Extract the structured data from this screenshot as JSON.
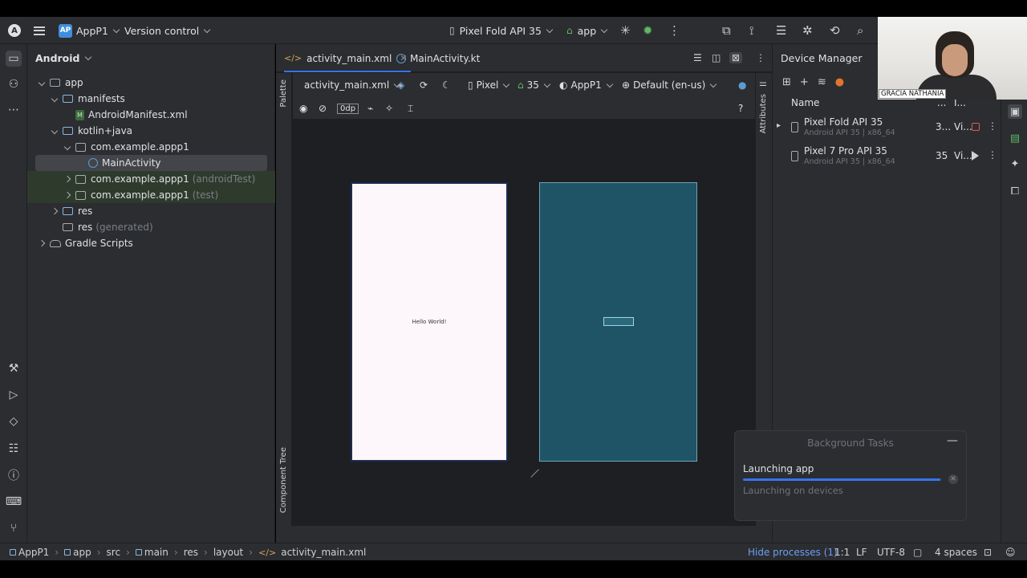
{
  "titlebar": {
    "project_badge": "AP",
    "project_name": "AppP1",
    "version_control": "Version control",
    "device": "Pixel Fold API 35",
    "run_config": "app"
  },
  "project_panel": {
    "view_mode": "Android",
    "tree": [
      {
        "label": "app",
        "suffix": ""
      },
      {
        "label": "manifests",
        "suffix": ""
      },
      {
        "label": "AndroidManifest.xml",
        "suffix": ""
      },
      {
        "label": "kotlin+java",
        "suffix": ""
      },
      {
        "label": "com.example.appp1",
        "suffix": ""
      },
      {
        "label": "MainActivity",
        "suffix": ""
      },
      {
        "label": "com.example.appp1",
        "suffix": "(androidTest)"
      },
      {
        "label": "com.example.appp1",
        "suffix": "(test)"
      },
      {
        "label": "res",
        "suffix": ""
      },
      {
        "label": "res",
        "suffix": "(generated)"
      },
      {
        "label": "Gradle Scripts",
        "suffix": ""
      }
    ]
  },
  "editor": {
    "tabs": [
      {
        "label": "activity_main.xml"
      },
      {
        "label": "MainActivity.kt"
      }
    ],
    "palette_label": "Palette",
    "component_tree_label": "Component Tree",
    "attributes_label": "Attributes",
    "toolbar": {
      "file": "activity_main.xml",
      "device": "Pixel",
      "api": "35",
      "theme": "AppP1",
      "locale": "Default (en-us)",
      "margin": "0dp",
      "help": "?"
    },
    "preview_text": "Hello World!"
  },
  "device_manager": {
    "title": "Device Manager",
    "column_name": "Name",
    "col2": "...",
    "col3": "I...",
    "devices": [
      {
        "name": "Pixel Fold API 35",
        "sub": "Android API 35 | x86_64",
        "api": "3...",
        "type": "Vi..."
      },
      {
        "name": "Pixel 7 Pro API 35",
        "sub": "Android API 35 | x86_64",
        "api": "35",
        "type": "Vi..."
      }
    ]
  },
  "background_tasks": {
    "title": "Background Tasks",
    "task": "Launching app",
    "subtask": "Launching on devices",
    "progress": 0.99
  },
  "webcam": {
    "label": "GRACIA NATHANIA"
  },
  "statusbar": {
    "crumbs": [
      "AppP1",
      "app",
      "src",
      "main",
      "res",
      "layout",
      "activity_main.xml"
    ],
    "hide_processes": "Hide processes (1)",
    "position": "1:1",
    "line_ending": "LF",
    "encoding": "UTF-8",
    "indent": "4 spaces"
  },
  "colors": {
    "accent": "#3574f0",
    "panel_bg": "#2b2d30",
    "editor_bg": "#1e1f22",
    "blueprint": "#1e5466"
  }
}
